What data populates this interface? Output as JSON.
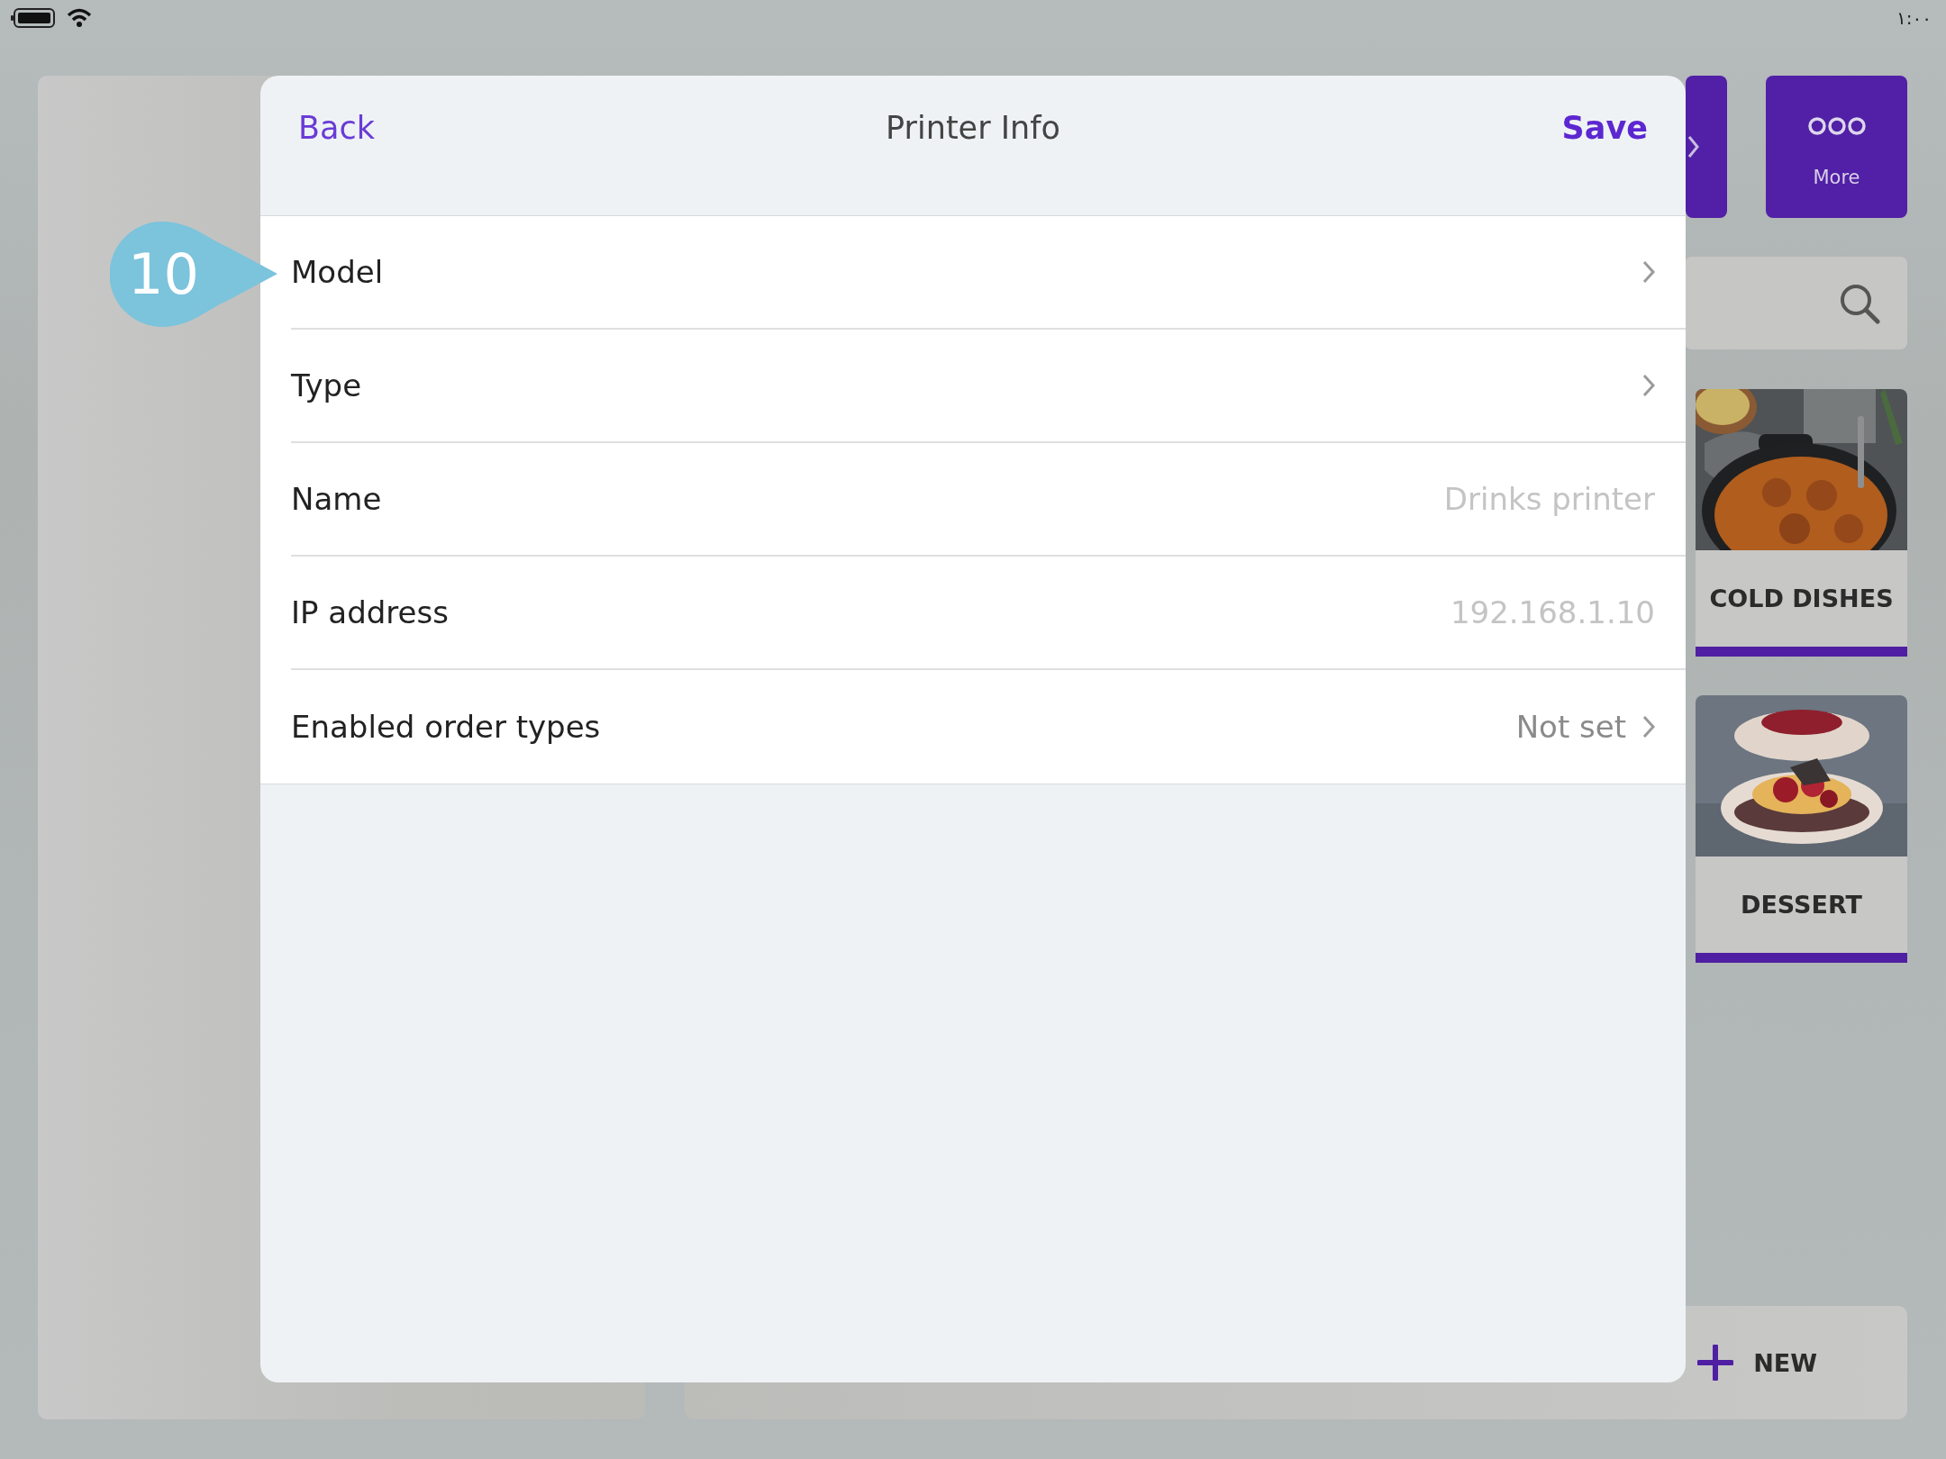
{
  "status_bar": {
    "time": "١:٠٠"
  },
  "background": {
    "top_buttons": [
      {
        "kind": "chevron"
      },
      {
        "kind": "more",
        "label": "More"
      }
    ],
    "categories": [
      {
        "label": "COLD DISHES",
        "kind": "picture"
      },
      {
        "label": "DESSERT",
        "kind": "picture"
      }
    ],
    "new_button": {
      "label": "NEW"
    }
  },
  "modal": {
    "back": "Back",
    "title": "Printer Info",
    "save": "Save",
    "rows": [
      {
        "label": "Model",
        "kind": "nav"
      },
      {
        "label": "Type",
        "kind": "nav"
      },
      {
        "label": "Name",
        "kind": "field",
        "placeholder": "Drinks printer"
      },
      {
        "label": "IP address",
        "kind": "field",
        "placeholder": "192.168.1.10"
      },
      {
        "label": "Enabled order types",
        "kind": "nav",
        "value": "Not set"
      }
    ]
  },
  "callout": {
    "label": "10"
  }
}
